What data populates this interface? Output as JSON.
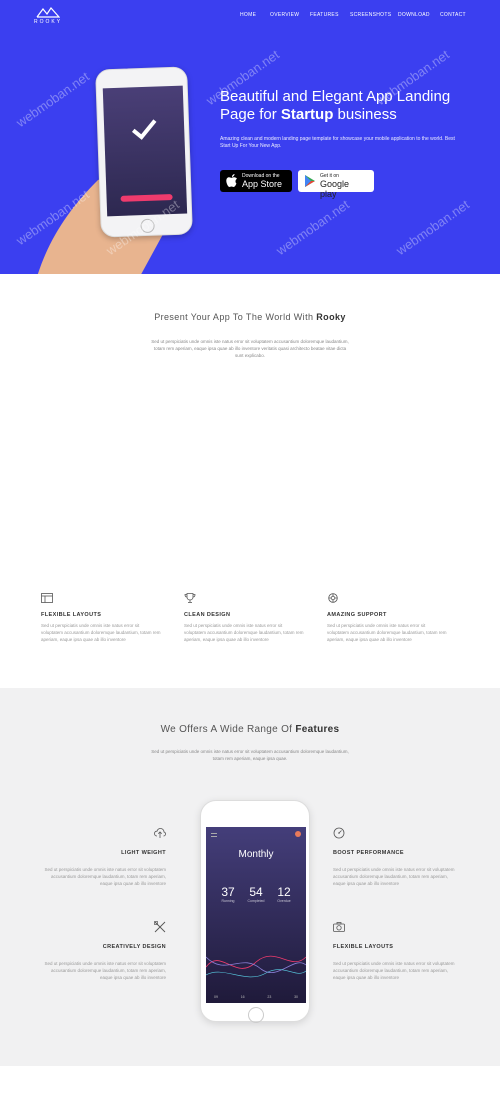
{
  "brand": {
    "name": "ROOKY"
  },
  "nav": [
    "HOME",
    "OVERVIEW",
    "FEATURES",
    "SCREENSHOTS",
    "DOWNLOAD",
    "CONTACT"
  ],
  "hero": {
    "title_line1": "Beautiful and Elegant App Landing",
    "title_line2_pre": "Page for ",
    "title_line2_bold": "Startup",
    "title_line2_post": " business",
    "description": "Amazing clean and modern landing page template for showcase your mobile application to the world. Best Start Up For Your New App.",
    "apple": {
      "small": "Download on the",
      "big": "App Store"
    },
    "google": {
      "small": "Get it on",
      "big": "Google play"
    }
  },
  "watermark": "webmoban.net",
  "intro": {
    "title_pre": "Present Your App To The World With ",
    "title_bold": "Rooky",
    "text": "Sed ut perspiciatis unde omnis iste natus error sit voluptatem accusantium doloremque laudantium, totam rem aperiam, eaque ipsa quae ab illo inventore veritatis quasi architecto beatae vitae dicta sunt explicabo."
  },
  "features": [
    {
      "icon": "layout-icon",
      "title": "FLEXIBLE LAYOUTS",
      "text": "Sed ut perspiciatis unde omnis iste natus error sit voluptatem accusantium doloremque laudantium, totam rem aperiam, eaque ipsa quae ab illo inventore"
    },
    {
      "icon": "trophy-icon",
      "title": "CLEAN DESIGN",
      "text": "Sed ut perspiciatis unde omnis iste natus error sit voluptatem accusantium doloremque laudantium, totam rem aperiam, eaque ipsa quae ab illo inventore"
    },
    {
      "icon": "support-icon",
      "title": "AMAZING SUPPORT",
      "text": "Sed ut perspiciatis unde omnis iste natus error sit voluptatem accusantium doloremque laudantium, totam rem aperiam, eaque ipsa quae ab illo inventore"
    }
  ],
  "range": {
    "title_pre": "We Offers A Wide Range Of ",
    "title_bold": "Features",
    "text": "Sed ut perspiciatis unde omnis iste natus error sit voluptatem accusantium doloremque laudantium, totam rem aperiam, eaque ipsa quae.",
    "items": [
      {
        "icon": "cloud-upload-icon",
        "title": "LIGHT WEIGHT",
        "text": "Sed ut perspiciatis unde omnis iste natus error sit voluptatem accusantium doloremque laudantium, totam rem aperiam, eaque ipsa quae ab illo inventore"
      },
      {
        "icon": "speedometer-icon",
        "title": "BOOST PERFORMANCE",
        "text": "Sed ut perspiciatis unde omnis iste natus error sit voluptatem accusantium doloremque laudantium, totam rem aperiam, eaque ipsa quae ab illo inventore"
      },
      {
        "icon": "design-tools-icon",
        "title": "CREATIVELY DESIGN",
        "text": "Sed ut perspiciatis unde omnis iste natus error sit voluptatem accusantium doloremque laudantium, totam rem aperiam, eaque ipsa quae ab illo inventore"
      },
      {
        "icon": "camera-icon",
        "title": "FLEXIBLE LAYOUTS",
        "text": "Sed ut perspiciatis unde omnis iste natus error sit voluptatem accusantium doloremque laudantium, totam rem aperiam, eaque ipsa quae ab illo inventore"
      }
    ],
    "app": {
      "title": "Monthly",
      "stats": [
        {
          "value": "37",
          "label": "Running"
        },
        {
          "value": "54",
          "label": "Completed"
        },
        {
          "value": "12",
          "label": "Overdue"
        }
      ],
      "tabs": [
        "09",
        "16",
        "23",
        "30"
      ]
    }
  },
  "colors": {
    "hero_bg": "#3b3ff0",
    "accent": "#ef3b6d",
    "section_bg": "#f1f1f2"
  }
}
